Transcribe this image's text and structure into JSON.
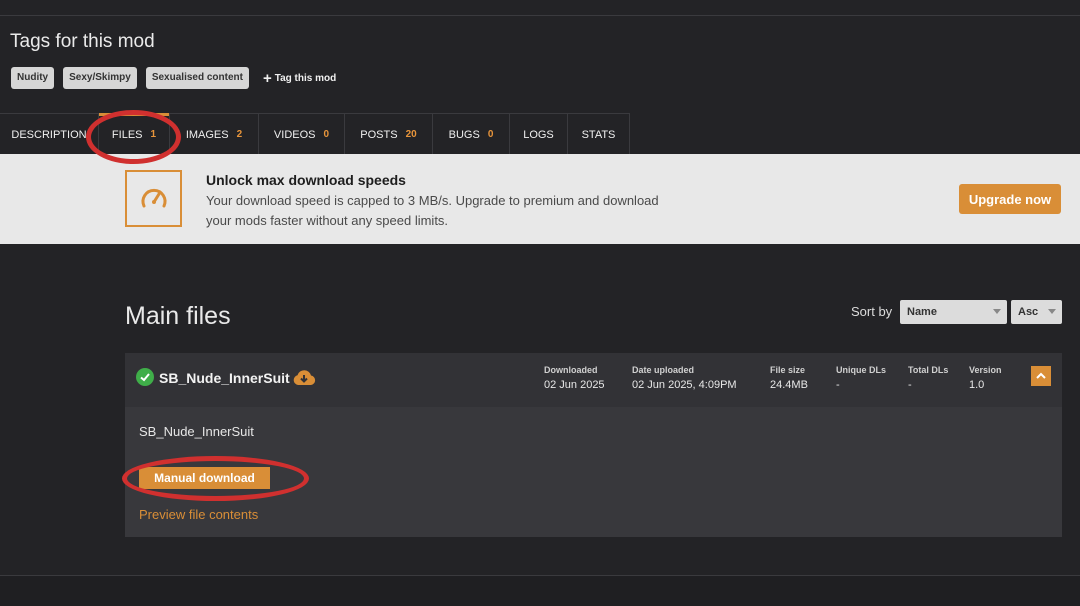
{
  "tags_section": {
    "title": "Tags for this mod",
    "tags": [
      "Nudity",
      "Sexy/Skimpy",
      "Sexualised content"
    ],
    "tag_this_mod": "Tag this mod"
  },
  "tabs": [
    {
      "label": "DESCRIPTION",
      "count": ""
    },
    {
      "label": "FILES",
      "count": "1"
    },
    {
      "label": "IMAGES",
      "count": "2"
    },
    {
      "label": "VIDEOS",
      "count": "0"
    },
    {
      "label": "POSTS",
      "count": "20"
    },
    {
      "label": "BUGS",
      "count": "0"
    },
    {
      "label": "LOGS",
      "count": ""
    },
    {
      "label": "STATS",
      "count": ""
    }
  ],
  "active_tab": "FILES",
  "banner": {
    "title": "Unlock max download speeds",
    "text": "Your download speed is capped to 3 MB/s. Upgrade to premium and download your mods faster without any speed limits.",
    "button": "Upgrade now",
    "icon": "speedometer-icon"
  },
  "main_files": {
    "title": "Main files",
    "sort_label": "Sort by",
    "sort_field": "Name",
    "sort_order": "Asc"
  },
  "file": {
    "name": "SB_Nude_InnerSuit",
    "description": "SB_Nude_InnerSuit",
    "meta": [
      {
        "label": "Downloaded",
        "value": "02 Jun 2025"
      },
      {
        "label": "Date uploaded",
        "value": "02 Jun 2025, 4:09PM"
      },
      {
        "label": "File size",
        "value": "24.4MB"
      },
      {
        "label": "Unique DLs",
        "value": "-"
      },
      {
        "label": "Total DLs",
        "value": "-"
      },
      {
        "label": "Version",
        "value": "1.0"
      }
    ],
    "manual_download": "Manual download",
    "preview": "Preview file contents"
  },
  "colors": {
    "accent": "#d98e37",
    "background": "#232326",
    "annotation_ring": "#d0302f",
    "check": "#3fae49"
  }
}
